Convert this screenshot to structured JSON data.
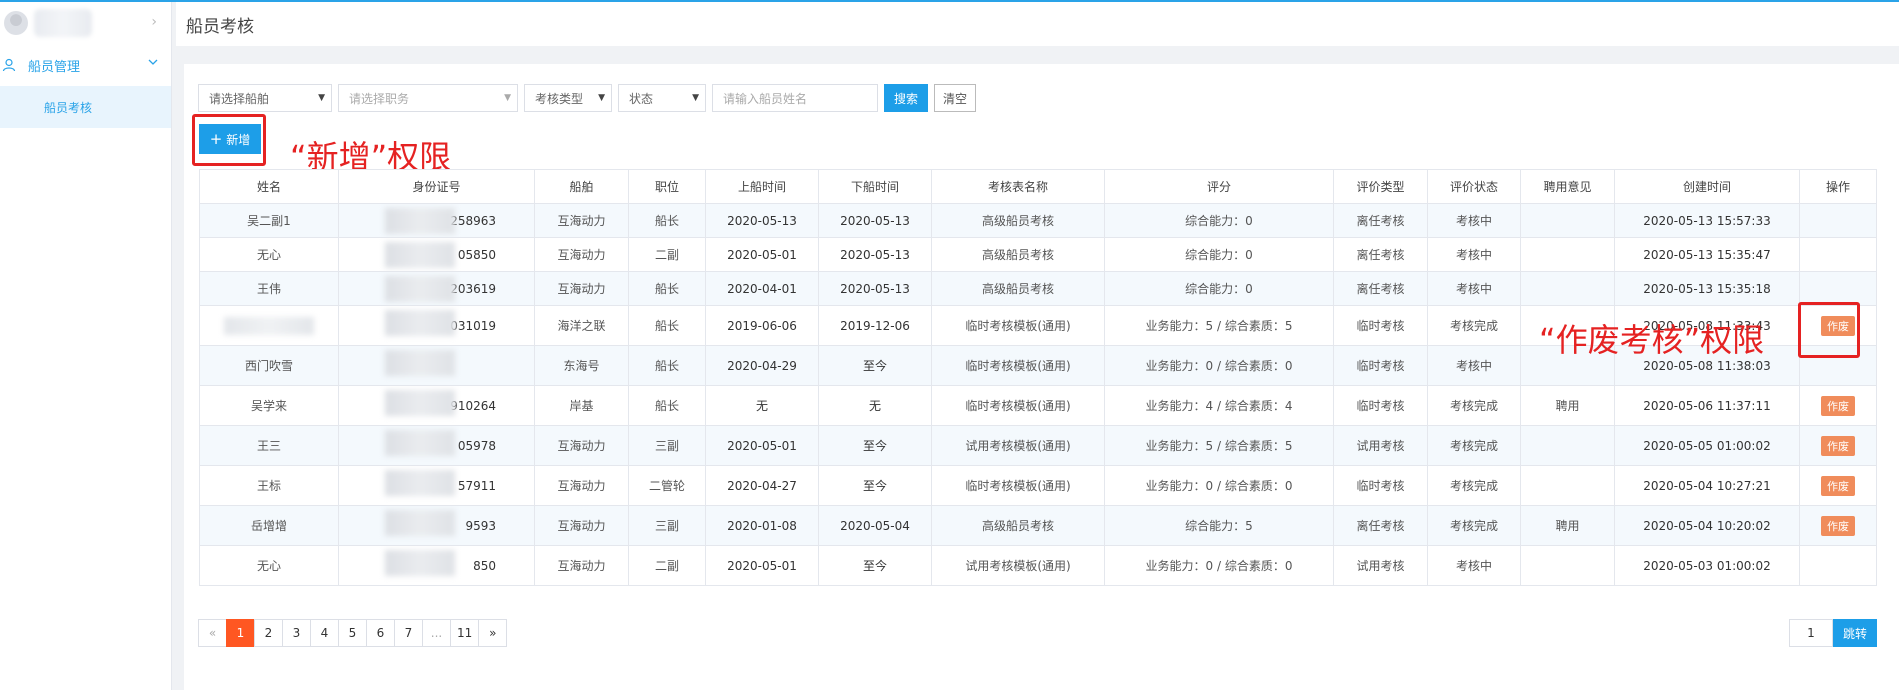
{
  "page_title": "船员考核",
  "sidebar": {
    "group_label": "船员管理",
    "item_label": "船员考核"
  },
  "filters": {
    "ship_placeholder": "请选择船舶",
    "duty_placeholder": "请选择职务",
    "type_label": "考核类型",
    "status_label": "状态",
    "name_placeholder": "请输入船员姓名",
    "search_label": "搜索",
    "clear_label": "清空"
  },
  "add_button_label": "新增",
  "annotations": {
    "add_permission": "“新增”权限",
    "void_permission": "“作废考核”权限"
  },
  "table": {
    "headers": [
      "姓名",
      "身份证号",
      "船舶",
      "职位",
      "上船时间",
      "下船时间",
      "考核表名称",
      "评分",
      "评价类型",
      "评价状态",
      "聘用意见",
      "创建时间",
      "操作"
    ],
    "rows": [
      [
        "吴二副1",
        "258963",
        "互海动力",
        "船长",
        "2020-05-13",
        "2020-05-13",
        "高级船员考核",
        "综合能力：0",
        "离任考核",
        "考核中",
        "",
        "2020-05-13 15:57:33",
        ""
      ],
      [
        "无心",
        "05850",
        "互海动力",
        "二副",
        "2020-05-01",
        "2020-05-13",
        "高级船员考核",
        "综合能力：0",
        "离任考核",
        "考核中",
        "",
        "2020-05-13 15:35:47",
        ""
      ],
      [
        "王伟",
        "203619",
        "互海动力",
        "船长",
        "2020-04-01",
        "2020-05-13",
        "高级船员考核",
        "综合能力：0",
        "离任考核",
        "考核中",
        "",
        "2020-05-13 15:35:18",
        ""
      ],
      [
        "",
        "031019",
        "海洋之联",
        "船长",
        "2019-06-06",
        "2019-12-06",
        "临时考核模板(通用)",
        "业务能力：5 / 综合素质：5",
        "临时考核",
        "考核完成",
        "",
        "2020-05-08 11:33:43",
        "作废"
      ],
      [
        "西门吹雪",
        "",
        "东海号",
        "船长",
        "2020-04-29",
        "至今",
        "临时考核模板(通用)",
        "业务能力：0 / 综合素质：0",
        "临时考核",
        "考核中",
        "",
        "2020-05-08 11:38:03",
        ""
      ],
      [
        "吴学来",
        "910264",
        "岸基",
        "船长",
        "无",
        "无",
        "临时考核模板(通用)",
        "业务能力：4 / 综合素质：4",
        "临时考核",
        "考核完成",
        "聘用",
        "2020-05-06 11:37:11",
        "作废"
      ],
      [
        "王三",
        "05978",
        "互海动力",
        "三副",
        "2020-05-01",
        "至今",
        "试用考核模板(通用)",
        "业务能力：5 / 综合素质：5",
        "试用考核",
        "考核完成",
        "",
        "2020-05-05 01:00:02",
        "作废"
      ],
      [
        "王标",
        "57911",
        "互海动力",
        "二管轮",
        "2020-04-27",
        "至今",
        "临时考核模板(通用)",
        "业务能力：0 / 综合素质：0",
        "临时考核",
        "考核完成",
        "",
        "2020-05-04 10:27:21",
        "作废"
      ],
      [
        "岳增增",
        "9593",
        "互海动力",
        "三副",
        "2020-01-08",
        "2020-05-04",
        "高级船员考核",
        "综合能力：5",
        "离任考核",
        "考核完成",
        "聘用",
        "2020-05-04 10:20:02",
        "作废"
      ],
      [
        "无心",
        "850",
        "互海动力",
        "二副",
        "2020-05-01",
        "至今",
        "试用考核模板(通用)",
        "业务能力：0 / 综合素质：0",
        "试用考核",
        "考核中",
        "",
        "2020-05-03 01:00:02",
        ""
      ]
    ]
  },
  "pagination": {
    "prev": "«",
    "pages": [
      "1",
      "2",
      "3",
      "4",
      "5",
      "6",
      "7",
      "...",
      "11"
    ],
    "next": "»",
    "jump_value": "1",
    "jump_label": "跳转"
  }
}
